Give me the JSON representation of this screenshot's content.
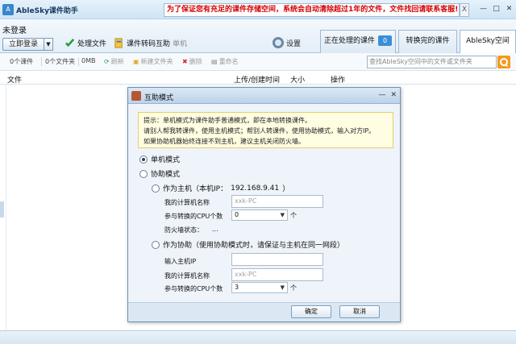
{
  "app": {
    "title": "AbleSky课件助手",
    "logo": "A"
  },
  "notice": {
    "text": "为了保证您有充足的课件存储空间，系统会自动清除超过1年的文件，文件找回请联系客服!",
    "close": "X"
  },
  "window": {
    "minimize": "—",
    "maximize": "□",
    "close": "✕"
  },
  "toolbar": {
    "user": "未登录",
    "login_label": "立即登录",
    "login_arrow": "▼",
    "process_label": "处理文件",
    "convert_label": "课件转码互助",
    "mode_label": "单机",
    "settings_label": "设置"
  },
  "tabs": [
    {
      "label": "正在处理的课件",
      "badge": "0"
    },
    {
      "label": "转换完的课件"
    },
    {
      "label": "AbleSky空间"
    }
  ],
  "subbar": {
    "count_files": "0个课件",
    "count_folders": "0个文件夹",
    "size": "0MB",
    "refresh": "刷新",
    "new_folder": "新建文件夹",
    "delete": "删除",
    "rename": "重命名",
    "search_placeholder": "查找AbleSky空间中的文件或文件夹"
  },
  "columns": {
    "file": "文件",
    "time": "上传/创建时间",
    "size": "大小",
    "action": "操作"
  },
  "dialog": {
    "title": "互助模式",
    "min": "—",
    "close": "✕",
    "tip": [
      "提示：单机模式为课件助手普通模式，即在本地转换课件。",
      "请别人帮我转课件，使用主机模式；帮别人转课件，使用协助模式，输入对方IP。",
      "如果协助机器始终连接不到主机，建议主机关闭防火墙。"
    ],
    "standalone": "单机模式",
    "mutual": "协助模式",
    "host_option": "作为主机（本机IP：",
    "host_ip": "192.168.9.41",
    "host_option_close": "）",
    "host_name_label": "我的计算机名称",
    "host_name_value": "xxk-PC",
    "host_cpu_label": "参与转换的CPU个数",
    "host_cpu_value": "0",
    "unit": "个",
    "firewall_label": "防火墙状态：",
    "firewall_value": "...",
    "assist_option": "作为协助（使用协助模式时，请保证与主机在同一网段）",
    "assist_ip_label": "输入主机IP",
    "assist_name_label": "我的计算机名称",
    "assist_name_value": "xxk-PC",
    "assist_cpu_label": "参与转换的CPU个数",
    "assist_cpu_value": "3",
    "ok": "确定",
    "cancel": "取消"
  }
}
